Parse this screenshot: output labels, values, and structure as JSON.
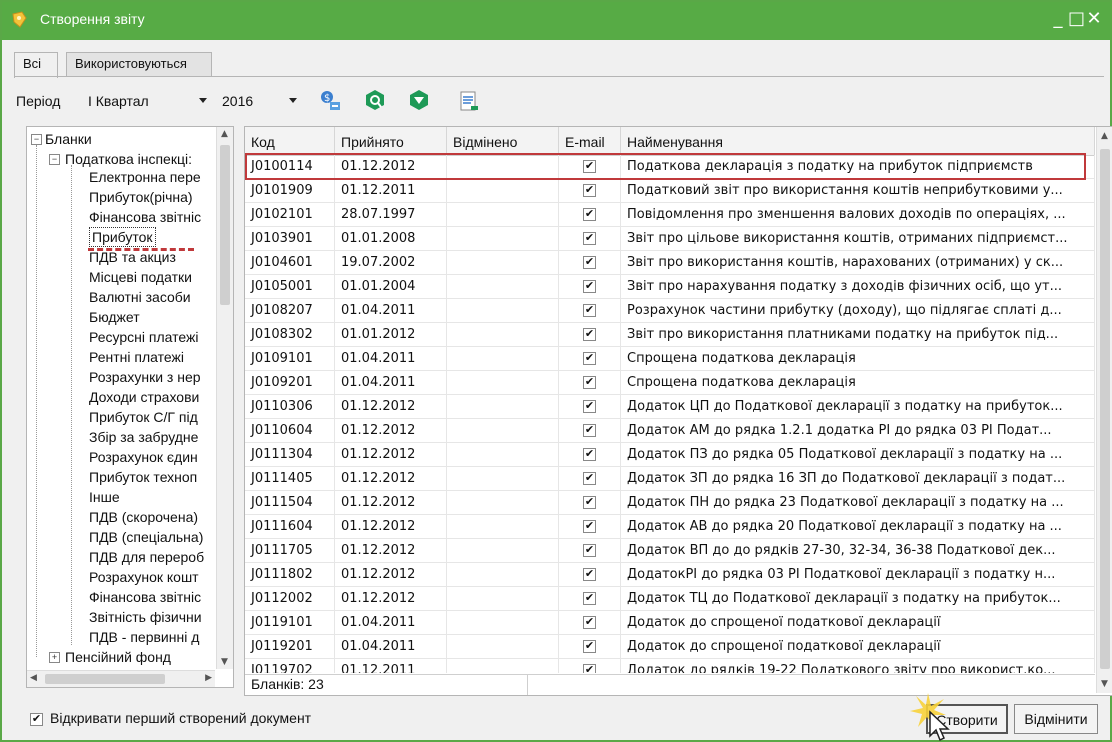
{
  "window": {
    "title": "Створення звіту",
    "controls": [
      "_",
      "□",
      "✕"
    ]
  },
  "tabs": [
    {
      "label": "Всі",
      "active": true
    },
    {
      "label": "Використовуються",
      "active": false
    }
  ],
  "toolbar": {
    "period_label": "Період",
    "quarter_value": "I Квартал",
    "year_value": "2016"
  },
  "tree": {
    "root": "Бланки",
    "group": "Податкова інспекція",
    "group_short": "Податкова інспекці:",
    "items": [
      "Електронна пере",
      "Прибуток(річна)",
      "Фінансова звітніс",
      "Прибуток",
      "ПДВ та акциз",
      "Місцеві податки",
      "Валютні засоби",
      "Бюджет",
      "Ресурсні платежі",
      "Рентні платежі",
      "Розрахунки з нер",
      "Доходи страхови",
      "Прибуток С/Г під",
      "Збір за забрудне",
      "Розрахунок єдин",
      "Прибуток техноп",
      "Інше",
      "ПДВ (скорочена)",
      "ПДВ (спеціальна)",
      "ПДВ для перероб",
      "Розрахунок кошт",
      "Фінансова звітніс",
      "Звітність фізични",
      "ПДВ - первинні д"
    ],
    "last_group": "Пенсійний фонд"
  },
  "grid": {
    "columns": [
      "Код",
      "Прийнято",
      "Відмінено",
      "E-mail",
      "Найменування"
    ],
    "rows": [
      {
        "code": "J0100114",
        "accepted": "01.12.2012",
        "cancelled": "",
        "email": "✔",
        "name": "Податкова декларація з податку на прибуток підприємств"
      },
      {
        "code": "J0101909",
        "accepted": "01.12.2011",
        "cancelled": "",
        "email": "✔",
        "name": "Податковий звіт про використання коштів неприбутковими у..."
      },
      {
        "code": "J0102101",
        "accepted": "28.07.1997",
        "cancelled": "",
        "email": "✔",
        "name": "Повідомлення про зменшення валових доходів по операціях, ..."
      },
      {
        "code": "J0103901",
        "accepted": "01.01.2008",
        "cancelled": "",
        "email": "✔",
        "name": "Звіт про цільове використання коштів, отриманих підприємст..."
      },
      {
        "code": "J0104601",
        "accepted": "19.07.2002",
        "cancelled": "",
        "email": "✔",
        "name": "Звіт про використання коштів, нарахованих (отриманих) у ск..."
      },
      {
        "code": "J0105001",
        "accepted": "01.01.2004",
        "cancelled": "",
        "email": "✔",
        "name": "Звіт про нарахування податку з доходів фізичних осіб, що ут..."
      },
      {
        "code": "J0108207",
        "accepted": "01.04.2011",
        "cancelled": "",
        "email": "✔",
        "name": "Розрахунок частини прибутку (доходу), що підлягає сплаті д..."
      },
      {
        "code": "J0108302",
        "accepted": "01.01.2012",
        "cancelled": "",
        "email": "✔",
        "name": "Звіт  про використання платниками податку на прибуток під..."
      },
      {
        "code": "J0109101",
        "accepted": "01.04.2011",
        "cancelled": "",
        "email": "✔",
        "name": "Спрощена податкова декларація"
      },
      {
        "code": "J0109201",
        "accepted": "01.04.2011",
        "cancelled": "",
        "email": "✔",
        "name": "Спрощена податкова декларація"
      },
      {
        "code": "J0110306",
        "accepted": "01.12.2012",
        "cancelled": "",
        "email": "✔",
        "name": "Додаток ЦП до Податкової декларації з податку на прибуток..."
      },
      {
        "code": "J0110604",
        "accepted": "01.12.2012",
        "cancelled": "",
        "email": "✔",
        "name": "Додаток АМ до рядка 1.2.1 додатка РІ до рядка 03 РІ  Подат..."
      },
      {
        "code": "J0111304",
        "accepted": "01.12.2012",
        "cancelled": "",
        "email": "✔",
        "name": "Додаток ПЗ до рядка 05 Податкової декларації з податку на ..."
      },
      {
        "code": "J0111405",
        "accepted": "01.12.2012",
        "cancelled": "",
        "email": "✔",
        "name": "Додаток ЗП до рядка 16 ЗП до Податкової декларації з подат..."
      },
      {
        "code": "J0111504",
        "accepted": "01.12.2012",
        "cancelled": "",
        "email": "✔",
        "name": "Додаток ПН до рядка 23 Податкової декларації з податку на ..."
      },
      {
        "code": "J0111604",
        "accepted": "01.12.2012",
        "cancelled": "",
        "email": "✔",
        "name": "Додаток АВ до рядка 20 Податкової декларації з податку на ..."
      },
      {
        "code": "J0111705",
        "accepted": "01.12.2012",
        "cancelled": "",
        "email": "✔",
        "name": "Додаток ВП до до рядків 27-30, 32-34, 36-38 Податкової дек..."
      },
      {
        "code": "J0111802",
        "accepted": "01.12.2012",
        "cancelled": "",
        "email": "✔",
        "name": "ДодатокРІ до рядка 03 РІ Податкової декларації з податку н..."
      },
      {
        "code": "J0112002",
        "accepted": "01.12.2012",
        "cancelled": "",
        "email": "✔",
        "name": "Додаток ТЦ до Податкової декларації з податку на прибуток..."
      },
      {
        "code": "J0119101",
        "accepted": "01.04.2011",
        "cancelled": "",
        "email": "✔",
        "name": "Додаток до спрощеної податкової декларації"
      },
      {
        "code": "J0119201",
        "accepted": "01.04.2011",
        "cancelled": "",
        "email": "✔",
        "name": "Додаток до спрощеної податкової декларації"
      },
      {
        "code": "J0119702",
        "accepted": "01.12.2011",
        "cancelled": "",
        "email": "✔",
        "name": "Додаток до рядків 19-22 Податкового звіту про використ.ко..."
      }
    ],
    "footer_count": "Бланків: 23"
  },
  "bottom": {
    "open_first_label": "Відкривати перший створений документ",
    "open_first_checked": "✔",
    "create_label": "Створити",
    "cancel_label": "Відмінити"
  },
  "colors": {
    "title_bar": "#57ab45",
    "highlight": "#c0393b"
  },
  "icons": [
    "app-icon",
    "export-icon",
    "search-icon",
    "shield-icon",
    "document-icon",
    "expand-icon",
    "collapse-icon",
    "checkbox-icon",
    "cursor-icon"
  ]
}
